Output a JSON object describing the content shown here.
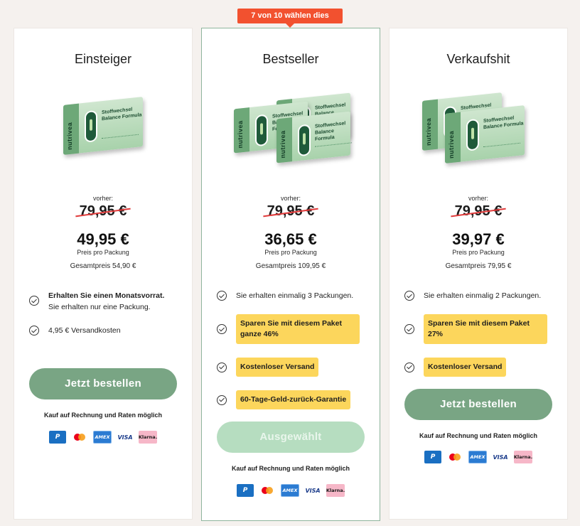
{
  "badge": "7 von 10 wählen dies",
  "colors": {
    "button": "#79a584",
    "button_selected": "#b6ddc0",
    "highlight": "#fcd65c",
    "badge": "#f2512f",
    "strike": "#e03a3a"
  },
  "product_box": {
    "brand": "nutrivea",
    "label": "Stoffwechsel Balance Formula"
  },
  "payments": {
    "note": "Kauf auf Rechnung und Raten möglich",
    "methods": [
      "P",
      "",
      "AMEX",
      "VISA",
      "Klarna."
    ]
  },
  "cards": [
    {
      "title": "Einsteiger",
      "packs": 1,
      "was_label": "vorher:",
      "was_price": "79,95 €",
      "price": "49,95 €",
      "per": "Preis pro Packung",
      "total": "Gesamtpreis 54,90 €",
      "features": [
        {
          "bold": "Erhalten Sie einen Monatsvorrat.",
          "text": "Sie erhalten nur eine Packung."
        },
        {
          "text": "4,95 € Versandkosten"
        }
      ],
      "button": "Jetzt bestellen"
    },
    {
      "title": "Bestseller",
      "packs": 3,
      "was_label": "vorher:",
      "was_price": "79,95 €",
      "price": "36,65 €",
      "per": "Preis pro Packung",
      "total": "Gesamtpreis 109,95 €",
      "features": [
        {
          "text": "Sie erhalten einmalig 3 Packungen."
        },
        {
          "highlight": "Sparen Sie mit diesem Paket ganze 46%"
        },
        {
          "highlight": "Kostenloser Versand"
        },
        {
          "highlight": "60-Tage-Geld-zurück-Garantie"
        }
      ],
      "button": "Ausgewählt"
    },
    {
      "title": "Verkaufshit",
      "packs": 2,
      "was_label": "vorher:",
      "was_price": "79,95 €",
      "price": "39,97 €",
      "per": "Preis pro Packung",
      "total": "Gesamtpreis 79,95 €",
      "features": [
        {
          "text": "Sie erhalten einmalig 2 Packungen."
        },
        {
          "highlight": "Sparen Sie mit diesem Paket 27%"
        },
        {
          "highlight": "Kostenloser Versand"
        }
      ],
      "button": "Jetzt bestellen"
    }
  ]
}
